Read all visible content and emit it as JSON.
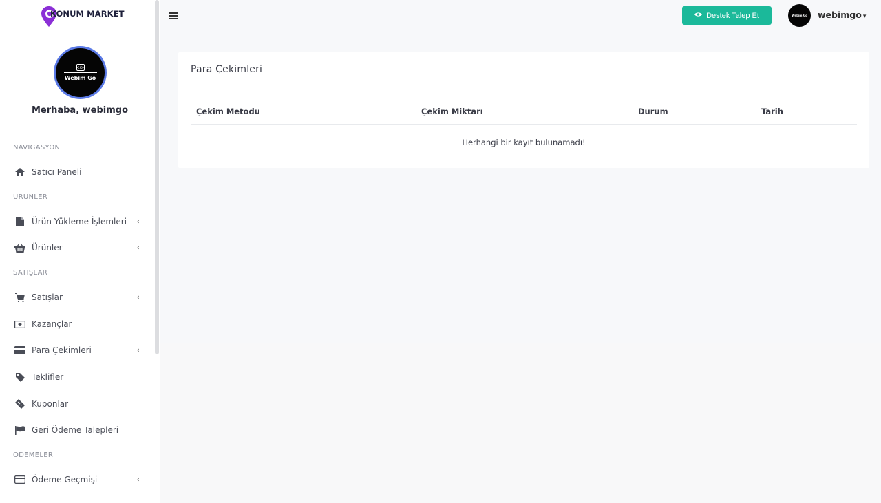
{
  "brand": {
    "name": "KONUM MARKET",
    "accent_color": "#8b2fd6"
  },
  "profile": {
    "avatar_text": "Webim Go",
    "avatar_code": "</>",
    "greeting": "Merhaba, webimgo"
  },
  "sidebar": {
    "sections": [
      {
        "label": "NAVIGASYON"
      },
      {
        "label": "ÜRÜNLER"
      },
      {
        "label": "SATIŞLAR"
      },
      {
        "label": "ÖDEMELER"
      }
    ],
    "items": [
      {
        "label": "Satıcı Paneli",
        "icon": "home-icon",
        "has_submenu": false
      },
      {
        "label": "Ürün Yükleme İşlemleri",
        "icon": "file-icon",
        "has_submenu": true
      },
      {
        "label": "Ürünler",
        "icon": "basket-icon",
        "has_submenu": true
      },
      {
        "label": "Satışlar",
        "icon": "cart-icon",
        "has_submenu": true
      },
      {
        "label": "Kazançlar",
        "icon": "money-icon",
        "has_submenu": false
      },
      {
        "label": "Para Çekimleri",
        "icon": "credit-card-icon",
        "has_submenu": true
      },
      {
        "label": "Teklifler",
        "icon": "tag-icon",
        "has_submenu": false
      },
      {
        "label": "Kuponlar",
        "icon": "ticket-icon",
        "has_submenu": false
      },
      {
        "label": "Geri Ödeme Talepleri",
        "icon": "flag-icon",
        "has_submenu": false
      },
      {
        "label": "Ödeme Geçmişi",
        "icon": "credit-card-icon",
        "has_submenu": true
      }
    ],
    "chevron": "‹"
  },
  "topbar": {
    "menu_icon": "hamburger-icon",
    "support_button": {
      "label": "Destek Talep Et",
      "icon": "eye-icon",
      "color": "#1bb99a"
    },
    "user": {
      "name": "webimgo",
      "avatar_text": "Webim Go",
      "caret": "▾"
    }
  },
  "main": {
    "card_title": "Para Çekimleri",
    "table": {
      "columns": [
        "Çekim Metodu",
        "Çekim Miktarı",
        "Durum",
        "Tarih"
      ],
      "rows": [],
      "empty_message": "Herhangi bir kayıt bulunamadı!"
    }
  }
}
